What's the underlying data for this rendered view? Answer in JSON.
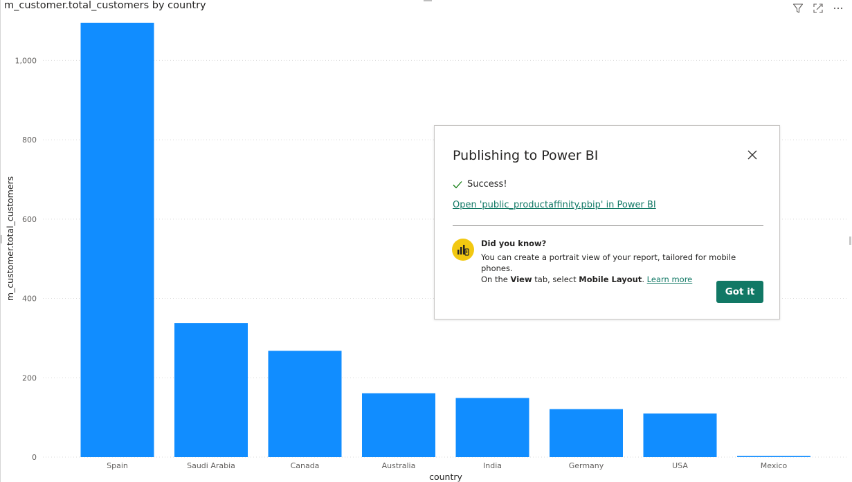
{
  "visual": {
    "title": "m_customer.total_customers by country",
    "header_icons": [
      "filter-icon",
      "focus-mode-icon",
      "more-options-icon"
    ]
  },
  "chart_data": {
    "type": "bar",
    "title": "m_customer.total_customers by country",
    "xlabel": "country",
    "ylabel": "m_customer.total_customers",
    "categories": [
      "Spain",
      "Saudi Arabia",
      "Canada",
      "Australia",
      "India",
      "Germany",
      "USA",
      "Mexico"
    ],
    "values": [
      1095,
      338,
      268,
      161,
      149,
      121,
      110,
      3
    ],
    "ylim": [
      0,
      1100
    ],
    "yticks": [
      0,
      200,
      400,
      600,
      800,
      1000
    ],
    "ytick_labels": [
      "0",
      "200",
      "400",
      "600",
      "800",
      "1,000"
    ],
    "grid": true,
    "bar_color": "#118dff"
  },
  "dialog": {
    "title": "Publishing to Power BI",
    "success_text": "Success!",
    "open_link": "Open 'public_productaffinity.pbip' in Power BI",
    "tip_heading": "Did you know?",
    "tip_line1": "You can create a portrait view of your report, tailored for mobile phones.",
    "tip_line2_a": "On the ",
    "tip_line2_view": "View",
    "tip_line2_b": " tab, select ",
    "tip_line2_mobile": "Mobile Layout",
    "tip_line2_c": ". ",
    "learn_more": "Learn more",
    "got_it": "Got it",
    "accent_color": "#117865",
    "tip_icon_color": "#f2c811"
  }
}
